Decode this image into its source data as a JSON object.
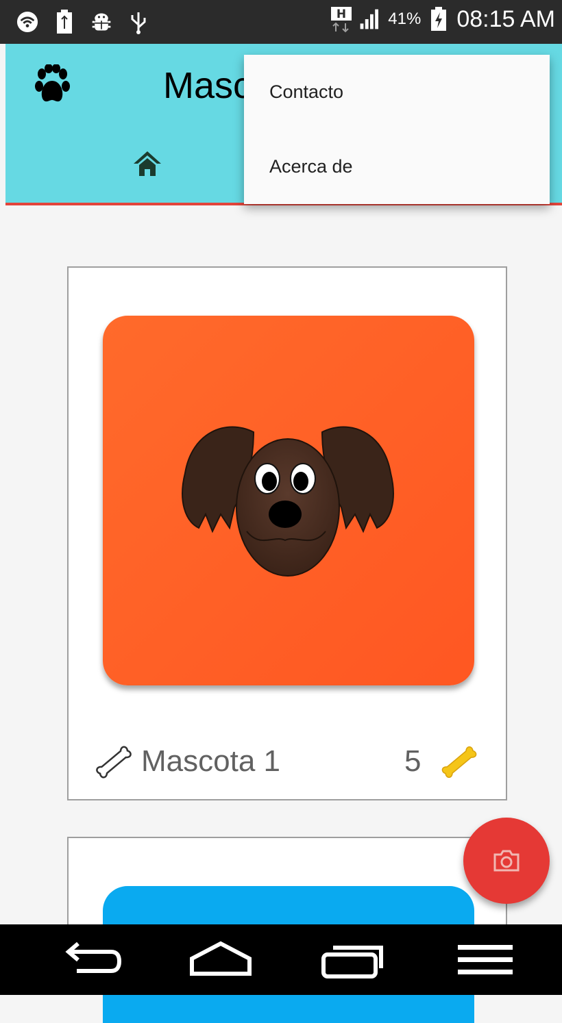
{
  "status_bar": {
    "battery": "41%",
    "time": "08:15 AM",
    "icons": [
      "wifi-icon",
      "usb-battery-icon",
      "android-debug-icon",
      "usb-icon",
      "hd-network-icon",
      "signal-icon",
      "charging-icon"
    ]
  },
  "app_bar": {
    "title": "Mascotas",
    "logo_icon": "paw-icon",
    "tab_icon": "home-icon",
    "background": "#66d9e3",
    "indicator_color": "#e2453b"
  },
  "overflow_menu": {
    "items": [
      {
        "label": "Contacto"
      },
      {
        "label": "Acerca de"
      }
    ]
  },
  "pets": [
    {
      "name": "Mascota 1",
      "likes": "5",
      "photo_color": "#ff5722",
      "rate_icon": "bone-outline-icon",
      "likes_icon": "bone-yellow-icon"
    },
    {
      "photo_color": "#0aaaf0"
    }
  ],
  "fab": {
    "icon": "camera-icon",
    "color": "#e53935"
  },
  "nav_bar": {
    "buttons": [
      "back-icon",
      "home-icon",
      "recents-icon",
      "menu-icon"
    ]
  }
}
